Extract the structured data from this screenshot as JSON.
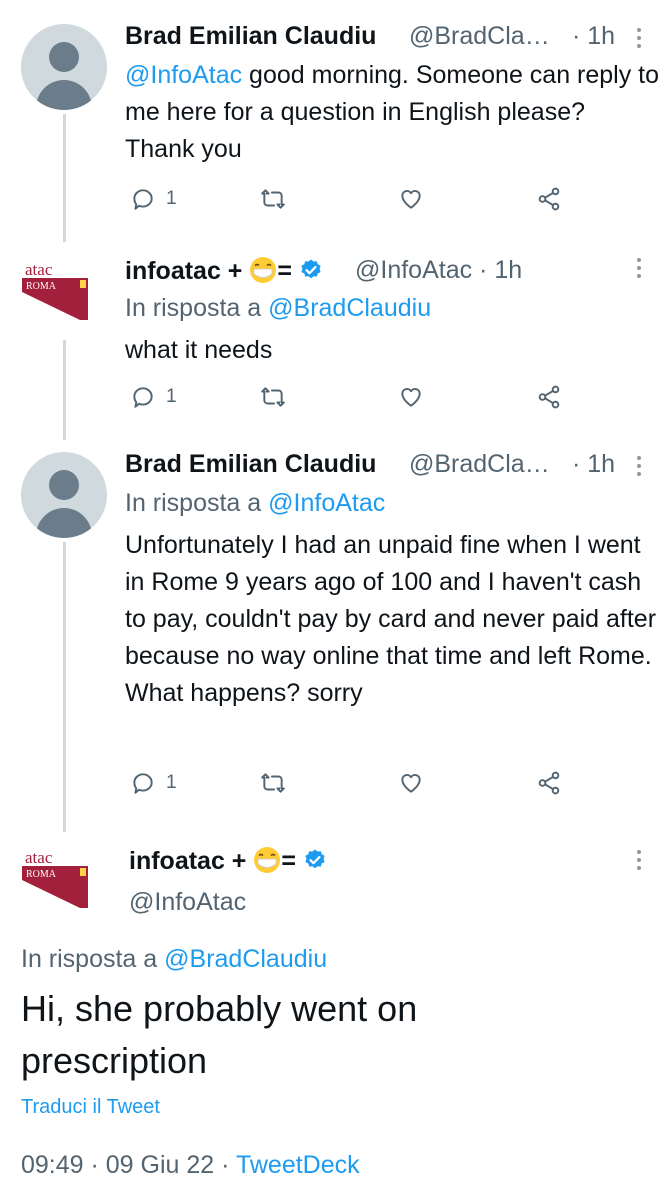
{
  "tweets": [
    {
      "name": "Brad Emilian Claudiu",
      "handle": "@BradCla…",
      "time": "· 1h",
      "mention": "@InfoAtac",
      "text": " good morning. Someone can reply to me here for a question in English please? Thank you",
      "reply_count": "1"
    },
    {
      "name": "infoatac +",
      "name_suffix": "=",
      "handle": "@InfoAtac · 1h",
      "replying_label": "In risposta a ",
      "replying_to": "@BradClaudiu",
      "text": "what it needs",
      "reply_count": "1"
    },
    {
      "name": "Brad Emilian Claudiu",
      "handle": "@BradCla…",
      "time": "· 1h",
      "replying_label": "In risposta a ",
      "replying_to": "@InfoAtac",
      "text": "Unfortunately I had an unpaid fine when I went in Rome 9 years ago of 100 and I haven't cash to pay, couldn't pay by card and never paid after because no way online that time and left Rome. What happens? sorry",
      "reply_count": "1"
    }
  ],
  "main_tweet": {
    "name": "infoatac +",
    "name_suffix": "=",
    "handle": "@InfoAtac",
    "replying_label": "In risposta a ",
    "replying_to": "@BradClaudiu",
    "text": "Hi, she probably went on prescription",
    "translate": "Traduci il Tweet",
    "timestamp": "09:49 · 09 Giu 22 · ",
    "source": "TweetDeck"
  },
  "logo": {
    "top": "atac",
    "bottom": "ROMA"
  },
  "colors": {
    "link": "#1d9bf0",
    "muted": "#536471",
    "atac_red": "#a3203c"
  }
}
